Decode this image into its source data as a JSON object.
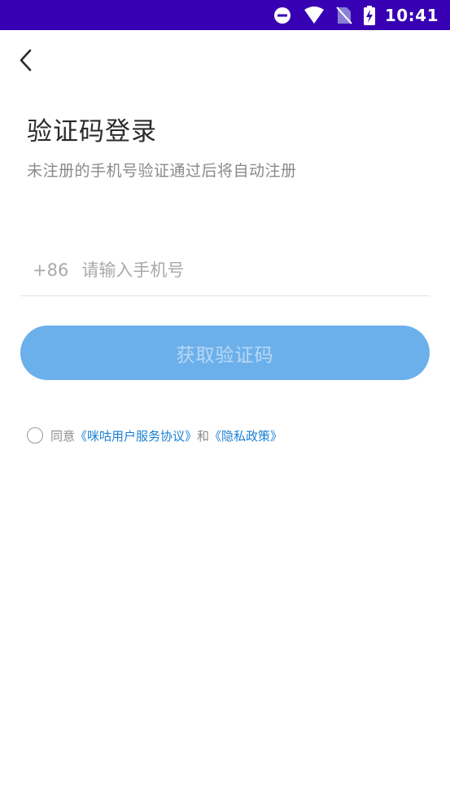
{
  "status_bar": {
    "time": "10:41",
    "icons": [
      "do-not-disturb-icon",
      "wifi-icon",
      "no-sim-icon",
      "battery-charging-icon"
    ]
  },
  "header": {
    "back_icon": "chevron-left-icon"
  },
  "login": {
    "title": "验证码登录",
    "subtitle": "未注册的手机号验证通过后将自动注册",
    "country_code": "+86",
    "phone_placeholder": "请输入手机号",
    "phone_value": "",
    "get_code_label": "获取验证码"
  },
  "agreement": {
    "checked": false,
    "prefix": "同意",
    "user_agreement": "《咪咕用户服务协议》",
    "and": "和",
    "privacy_policy": "《隐私政策》"
  },
  "colors": {
    "status_bar": "#3700b3",
    "button": "#6cb0eb",
    "link": "#1a7fd4"
  }
}
